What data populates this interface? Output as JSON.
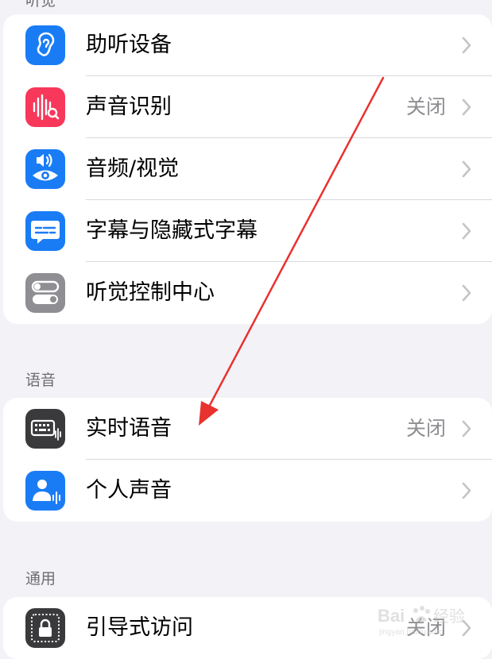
{
  "sections": {
    "hearing": {
      "items": [
        {
          "label": "助听设备",
          "value": "",
          "icon": "ear-icon",
          "color": "#1a7cf5"
        },
        {
          "label": "声音识别",
          "value": "关闭",
          "icon": "sound-recognition-icon",
          "color": "#f7385b"
        },
        {
          "label": "音频/视觉",
          "value": "",
          "icon": "audio-visual-icon",
          "color": "#1a7cf5"
        },
        {
          "label": "字幕与隐藏式字幕",
          "value": "",
          "icon": "captions-icon",
          "color": "#1a7cf5"
        },
        {
          "label": "听觉控制中心",
          "value": "",
          "icon": "toggles-icon",
          "color": "#8e8e93"
        }
      ]
    },
    "speech": {
      "header": "语音",
      "items": [
        {
          "label": "实时语音",
          "value": "关闭",
          "icon": "keyboard-wave-icon",
          "color": "#3a3a3c"
        },
        {
          "label": "个人声音",
          "value": "",
          "icon": "person-wave-icon",
          "color": "#1a7cf5"
        }
      ]
    },
    "general": {
      "header": "通用",
      "items": [
        {
          "label": "引导式访问",
          "value": "关闭",
          "icon": "lock-icon",
          "color": "#3a3a3c"
        }
      ]
    }
  },
  "annotation": {
    "type": "arrow",
    "color": "#e8322f"
  },
  "watermark": {
    "text": "Baidu 经验",
    "sub": "jingyan.baidu.com"
  }
}
